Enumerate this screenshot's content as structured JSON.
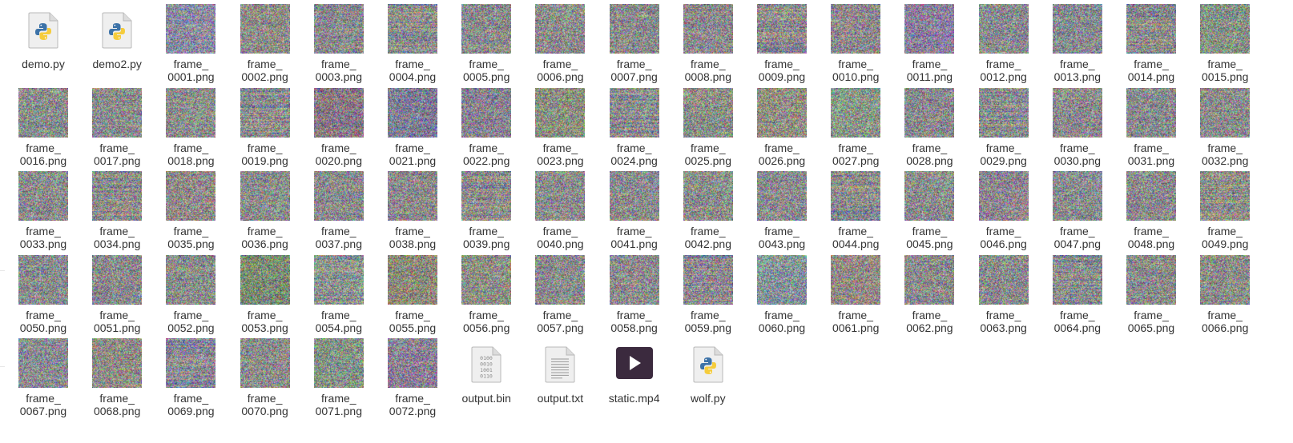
{
  "files": [
    {
      "kind": "python",
      "line1": "demo.py"
    },
    {
      "kind": "python",
      "line1": "demo2.py"
    },
    {
      "kind": "frame",
      "line1": "frame_",
      "line2": "0001.png",
      "tint": "#8a8ca0"
    },
    {
      "kind": "frame",
      "line1": "frame_",
      "line2": "0002.png",
      "tint": "#8f8d8a"
    },
    {
      "kind": "frame",
      "line1": "frame_",
      "line2": "0003.png",
      "tint": "#8b8c8e"
    },
    {
      "kind": "frame",
      "line1": "frame_",
      "line2": "0004.png",
      "tint": "#8c8d8d"
    },
    {
      "kind": "frame",
      "line1": "frame_",
      "line2": "0005.png",
      "tint": "#8c8c8e"
    },
    {
      "kind": "frame",
      "line1": "frame_",
      "line2": "0006.png",
      "tint": "#8d8d8c"
    },
    {
      "kind": "frame",
      "line1": "frame_",
      "line2": "0007.png",
      "tint": "#8c8b8c"
    },
    {
      "kind": "frame",
      "line1": "frame_",
      "line2": "0008.png",
      "tint": "#8e8a8b"
    },
    {
      "kind": "frame",
      "line1": "frame_",
      "line2": "0009.png",
      "tint": "#8d8a8e"
    },
    {
      "kind": "frame",
      "line1": "frame_",
      "line2": "0010.png",
      "tint": "#8e8a8d"
    },
    {
      "kind": "frame",
      "line1": "frame_",
      "line2": "0011.png",
      "tint": "#8a7f9a"
    },
    {
      "kind": "frame",
      "line1": "frame_",
      "line2": "0012.png",
      "tint": "#8a8d8f"
    },
    {
      "kind": "frame",
      "line1": "frame_",
      "line2": "0013.png",
      "tint": "#8a8c90"
    },
    {
      "kind": "frame",
      "line1": "frame_",
      "line2": "0014.png",
      "tint": "#8b8b8d"
    },
    {
      "kind": "frame",
      "line1": "frame_",
      "line2": "0015.png",
      "tint": "#869386"
    },
    {
      "kind": "frame",
      "line1": "frame_",
      "line2": "0016.png",
      "tint": "#8b8e8c"
    },
    {
      "kind": "frame",
      "line1": "frame_",
      "line2": "0017.png",
      "tint": "#8c8d8b"
    },
    {
      "kind": "frame",
      "line1": "frame_",
      "line2": "0018.png",
      "tint": "#8c8c8c"
    },
    {
      "kind": "frame",
      "line1": "frame_",
      "line2": "0019.png",
      "tint": "#8c8b8e"
    },
    {
      "kind": "frame",
      "line1": "frame_",
      "line2": "0020.png",
      "tint": "#8a7a86"
    },
    {
      "kind": "frame",
      "line1": "frame_",
      "line2": "0021.png",
      "tint": "#7e7f95"
    },
    {
      "kind": "frame",
      "line1": "frame_",
      "line2": "0022.png",
      "tint": "#8a8490"
    },
    {
      "kind": "frame",
      "line1": "frame_",
      "line2": "0023.png",
      "tint": "#8c9080"
    },
    {
      "kind": "frame",
      "line1": "frame_",
      "line2": "0024.png",
      "tint": "#8a8a8f"
    },
    {
      "kind": "frame",
      "line1": "frame_",
      "line2": "0025.png",
      "tint": "#8a8e88"
    },
    {
      "kind": "frame",
      "line1": "frame_",
      "line2": "0026.png",
      "tint": "#928f84"
    },
    {
      "kind": "frame",
      "line1": "frame_",
      "line2": "0027.png",
      "tint": "#88958a"
    },
    {
      "kind": "frame",
      "line1": "frame_",
      "line2": "0028.png",
      "tint": "#8d8a8d"
    },
    {
      "kind": "frame",
      "line1": "frame_",
      "line2": "0029.png",
      "tint": "#8b8d8c"
    },
    {
      "kind": "frame",
      "line1": "frame_",
      "line2": "0030.png",
      "tint": "#8c8b8e"
    },
    {
      "kind": "frame",
      "line1": "frame_",
      "line2": "0031.png",
      "tint": "#8b8b8e"
    },
    {
      "kind": "frame",
      "line1": "frame_",
      "line2": "0032.png",
      "tint": "#8c8c8b"
    },
    {
      "kind": "frame",
      "line1": "frame_",
      "line2": "0033.png",
      "tint": "#8b8d8d"
    },
    {
      "kind": "frame",
      "line1": "frame_",
      "line2": "0034.png",
      "tint": "#8d8d8a"
    },
    {
      "kind": "frame",
      "line1": "frame_",
      "line2": "0035.png",
      "tint": "#918a8a"
    },
    {
      "kind": "frame",
      "line1": "frame_",
      "line2": "0036.png",
      "tint": "#8c8c8c"
    },
    {
      "kind": "frame",
      "line1": "frame_",
      "line2": "0037.png",
      "tint": "#8b8b8d"
    },
    {
      "kind": "frame",
      "line1": "frame_",
      "line2": "0038.png",
      "tint": "#8d8a8d"
    },
    {
      "kind": "frame",
      "line1": "frame_",
      "line2": "0039.png",
      "tint": "#8b8c8d"
    },
    {
      "kind": "frame",
      "line1": "frame_",
      "line2": "0040.png",
      "tint": "#8b8c8d"
    },
    {
      "kind": "frame",
      "line1": "frame_",
      "line2": "0041.png",
      "tint": "#8c8c8d"
    },
    {
      "kind": "frame",
      "line1": "frame_",
      "line2": "0042.png",
      "tint": "#8b8d8c"
    },
    {
      "kind": "frame",
      "line1": "frame_",
      "line2": "0043.png",
      "tint": "#8a8c8e"
    },
    {
      "kind": "frame",
      "line1": "frame_",
      "line2": "0044.png",
      "tint": "#8c8c8e"
    },
    {
      "kind": "frame",
      "line1": "frame_",
      "line2": "0045.png",
      "tint": "#8b8c8e"
    },
    {
      "kind": "frame",
      "line1": "frame_",
      "line2": "0046.png",
      "tint": "#8c8690"
    },
    {
      "kind": "frame",
      "line1": "frame_",
      "line2": "0047.png",
      "tint": "#8a8d90"
    },
    {
      "kind": "frame",
      "line1": "frame_",
      "line2": "0048.png",
      "tint": "#8c8b8d"
    },
    {
      "kind": "frame",
      "line1": "frame_",
      "line2": "0049.png",
      "tint": "#8c8d8a"
    },
    {
      "kind": "frame",
      "line1": "frame_",
      "line2": "0050.png",
      "tint": "#898c90"
    },
    {
      "kind": "frame",
      "line1": "frame_",
      "line2": "0051.png",
      "tint": "#8b8b8c"
    },
    {
      "kind": "frame",
      "line1": "frame_",
      "line2": "0052.png",
      "tint": "#8b8e8a"
    },
    {
      "kind": "frame",
      "line1": "frame_",
      "line2": "0053.png",
      "tint": "#7e8d74"
    },
    {
      "kind": "frame",
      "line1": "frame_",
      "line2": "0054.png",
      "tint": "#878f92"
    },
    {
      "kind": "frame",
      "line1": "frame_",
      "line2": "0055.png",
      "tint": "#8f8a7a"
    },
    {
      "kind": "frame",
      "line1": "frame_",
      "line2": "0056.png",
      "tint": "#8d8f86"
    },
    {
      "kind": "frame",
      "line1": "frame_",
      "line2": "0057.png",
      "tint": "#8c8e8c"
    },
    {
      "kind": "frame",
      "line1": "frame_",
      "line2": "0058.png",
      "tint": "#8c8c8d"
    },
    {
      "kind": "frame",
      "line1": "frame_",
      "line2": "0059.png",
      "tint": "#8e8991"
    },
    {
      "kind": "frame",
      "line1": "frame_",
      "line2": "0060.png",
      "tint": "#86949a"
    },
    {
      "kind": "frame",
      "line1": "frame_",
      "line2": "0061.png",
      "tint": "#928a86"
    },
    {
      "kind": "frame",
      "line1": "frame_",
      "line2": "0062.png",
      "tint": "#8c8b8d"
    },
    {
      "kind": "frame",
      "line1": "frame_",
      "line2": "0063.png",
      "tint": "#8b8c8d"
    },
    {
      "kind": "frame",
      "line1": "frame_",
      "line2": "0064.png",
      "tint": "#8b8c8e"
    },
    {
      "kind": "frame",
      "line1": "frame_",
      "line2": "0065.png",
      "tint": "#8c8c8c"
    },
    {
      "kind": "frame",
      "line1": "frame_",
      "line2": "0066.png",
      "tint": "#8b8e8a"
    },
    {
      "kind": "frame",
      "line1": "frame_",
      "line2": "0067.png",
      "tint": "#8a8c92"
    },
    {
      "kind": "frame",
      "line1": "frame_",
      "line2": "0068.png",
      "tint": "#8f8c85"
    },
    {
      "kind": "frame",
      "line1": "frame_",
      "line2": "0069.png",
      "tint": "#8a8a95"
    },
    {
      "kind": "frame",
      "line1": "frame_",
      "line2": "0070.png",
      "tint": "#8c8c8c"
    },
    {
      "kind": "frame",
      "line1": "frame_",
      "line2": "0071.png",
      "tint": "#869488"
    },
    {
      "kind": "frame",
      "line1": "frame_",
      "line2": "0072.png",
      "tint": "#8c8195"
    },
    {
      "kind": "binary",
      "line1": "output.bin",
      "glyph_lines": [
        "0100",
        "0010",
        "1001",
        "0110"
      ]
    },
    {
      "kind": "text",
      "line1": "output.txt"
    },
    {
      "kind": "video",
      "line1": "static.mp4"
    },
    {
      "kind": "python",
      "line1": "wolf.py"
    }
  ],
  "colors": {
    "python_blue": "#3d73a8",
    "python_yellow": "#f5cc3c",
    "video_bg": "#3b2a3e",
    "doc_fill": "#efefef",
    "doc_stroke": "#b8b8b8"
  }
}
